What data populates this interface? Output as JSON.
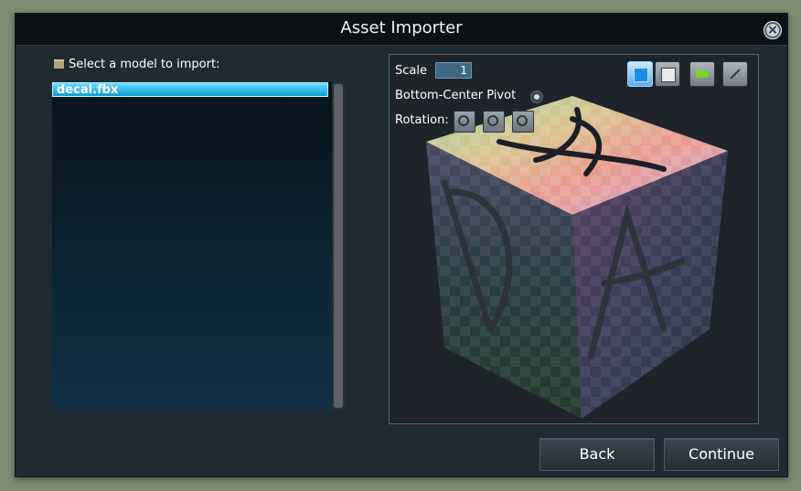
{
  "window": {
    "title": "Asset Importer"
  },
  "list": {
    "label": "Select a model to import:",
    "items": [
      {
        "name": "decal.fbx",
        "selected": true
      }
    ]
  },
  "preview": {
    "scale_label": "Scale",
    "scale_value": "1",
    "pivot_label": "Bottom-Center Pivot",
    "rotation_label": "Rotation:",
    "rotation_buttons": [
      "rotate-x-icon",
      "rotate-y-icon",
      "rotate-z-icon"
    ],
    "view_buttons": [
      "textured-view-icon",
      "solid-view-icon",
      "lod-view-icon",
      "size-view-icon"
    ]
  },
  "buttons": {
    "back": "Back",
    "continue": "Continue"
  },
  "colors": {
    "accent": "#0fa5dc",
    "dialog_bg": "#202a33",
    "titlebar_bg": "#0d1115"
  }
}
